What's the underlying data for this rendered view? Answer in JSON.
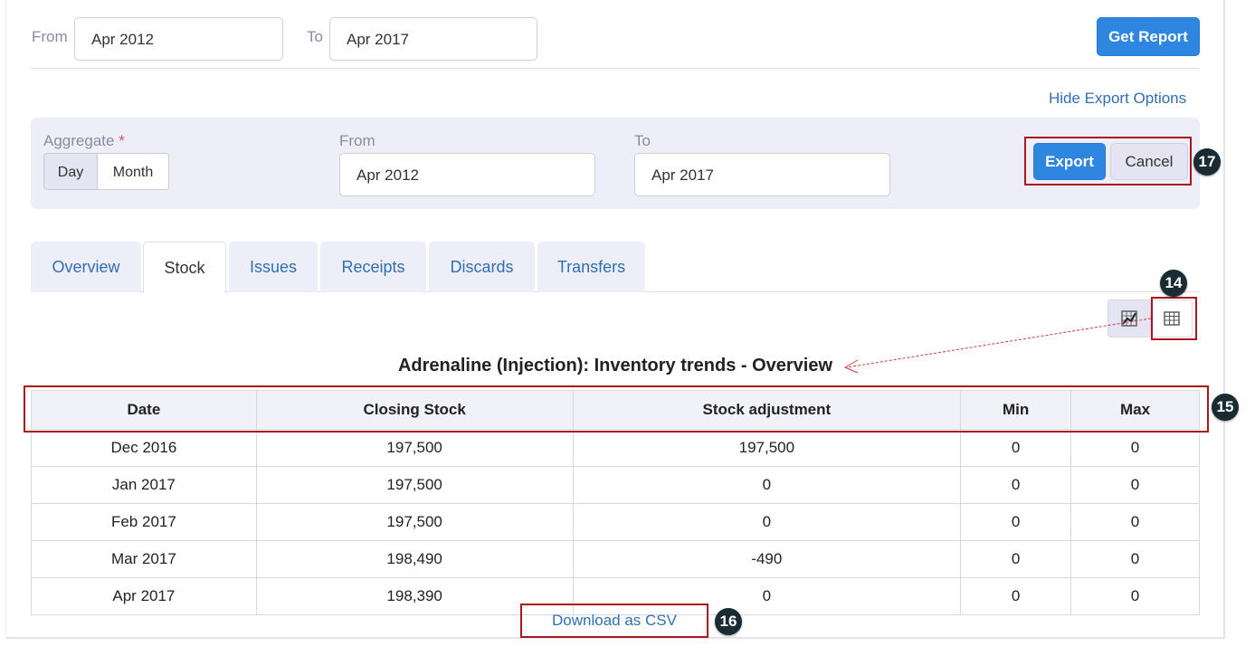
{
  "report_filter": {
    "from_label": "From",
    "from_value": "Apr 2012",
    "to_label": "To",
    "to_value": "Apr 2017",
    "get_report_label": "Get Report"
  },
  "hide_export_label": "Hide Export Options",
  "export_panel": {
    "aggregate_label": "Aggregate",
    "required_marker": "*",
    "aggregate_options": [
      "Day",
      "Month"
    ],
    "selected_aggregate": "Month",
    "from_label": "From",
    "from_value": "Apr 2012",
    "to_label": "To",
    "to_value": "Apr 2017",
    "export_label": "Export",
    "cancel_label": "Cancel"
  },
  "tabs": [
    {
      "label": "Overview",
      "active": false
    },
    {
      "label": "Stock",
      "active": true
    },
    {
      "label": "Issues",
      "active": false
    },
    {
      "label": "Receipts",
      "active": false
    },
    {
      "label": "Discards",
      "active": false
    },
    {
      "label": "Transfers",
      "active": false
    }
  ],
  "view_toggle": {
    "chart_icon": "chart-icon",
    "table_icon": "table-icon",
    "active": "table"
  },
  "report_title": "Adrenaline (Injection): Inventory trends - Overview",
  "table": {
    "headers": [
      "Date",
      "Closing Stock",
      "Stock adjustment",
      "Min",
      "Max"
    ],
    "rows": [
      [
        "Dec 2016",
        "197,500",
        "197,500",
        "0",
        "0"
      ],
      [
        "Jan 2017",
        "197,500",
        "0",
        "0",
        "0"
      ],
      [
        "Feb 2017",
        "197,500",
        "0",
        "0",
        "0"
      ],
      [
        "Mar 2017",
        "198,490",
        "-490",
        "0",
        "0"
      ],
      [
        "Apr 2017",
        "198,390",
        "0",
        "0",
        "0"
      ]
    ]
  },
  "download_csv_label": "Download as CSV",
  "annotations": {
    "badge_14": "14",
    "badge_15": "15",
    "badge_16": "16",
    "badge_17": "17"
  },
  "colors": {
    "primary": "#2f86e0",
    "link": "#2f6fb3",
    "annotation_red": "#a8181c",
    "badge": "#1a2b34"
  }
}
